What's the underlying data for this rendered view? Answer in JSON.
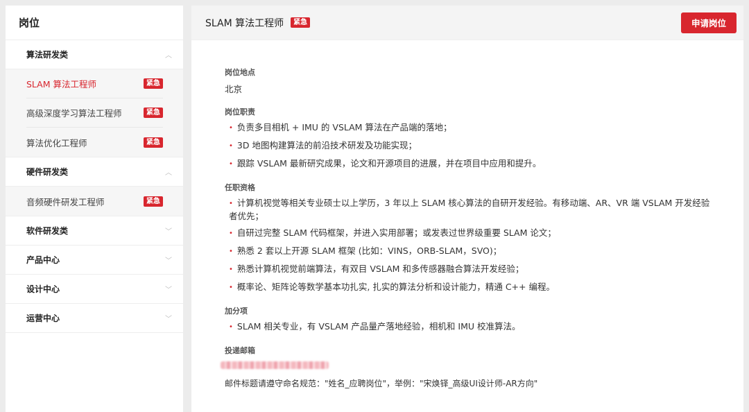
{
  "sidebar": {
    "title": "岗位",
    "groups": [
      {
        "name": "算法研发类",
        "expanded": true,
        "jobs": [
          {
            "title": "SLAM 算法工程师",
            "badge": "紧急",
            "active": true
          },
          {
            "title": "高级深度学习算法工程师",
            "badge": "紧急",
            "active": false
          },
          {
            "title": "算法优化工程师",
            "badge": "紧急",
            "active": false
          }
        ]
      },
      {
        "name": "硬件研发类",
        "expanded": true,
        "jobs": [
          {
            "title": "音频硬件研发工程师",
            "badge": "紧急",
            "active": false
          }
        ]
      },
      {
        "name": "软件研发类",
        "expanded": false,
        "jobs": []
      },
      {
        "name": "产品中心",
        "expanded": false,
        "jobs": []
      },
      {
        "name": "设计中心",
        "expanded": false,
        "jobs": []
      },
      {
        "name": "运营中心",
        "expanded": false,
        "jobs": []
      }
    ]
  },
  "detail": {
    "title": "SLAM 算法工程师",
    "badge": "紧急",
    "apply_label": "申请岗位",
    "location_label": "岗位地点",
    "location": "北京",
    "duties_label": "岗位职责",
    "duties": [
      "负责多目相机 + IMU 的 VSLAM 算法在产品端的落地；",
      "3D 地图构建算法的前沿技术研发及功能实现；",
      "跟踪 VSLAM 最新研究成果，论文和开源项目的进展，并在项目中应用和提升。"
    ],
    "requirements_label": "任职资格",
    "requirements": [
      "计算机视觉等相关专业硕士以上学历，3 年以上 SLAM 核心算法的自研开发经验。有移动端、AR、VR 端 VSLAM 开发经验者优先；",
      "自研过完整 SLAM 代码框架，并进入实用部署；或发表过世界级重要 SLAM 论文；",
      "熟悉 2 套以上开源 SLAM 框架 (比如：VINS，ORB-SLAM，SVO)；",
      "熟悉计算机视觉前端算法，有双目 VSLAM 和多传感器融合算法开发经验；",
      "概率论、矩阵论等数学基本功扎实, 扎实的算法分析和设计能力，精通 C++ 编程。"
    ],
    "bonus_label": "加分项",
    "bonus": [
      "SLAM 相关专业，有 VSLAM 产品量产落地经验，相机和 IMU 校准算法。"
    ],
    "email_label": "投递邮箱",
    "mail_note": "邮件标题请遵守命名规范：\"姓名_应聘岗位\"，举例：\"宋焕铎_高级UI设计师-AR方向\""
  },
  "colors": {
    "accent": "#d8262e",
    "background": "#ececec",
    "panel_header": "#f4f4f4"
  },
  "icons": {
    "expanded": "chevron-up-icon",
    "collapsed": "chevron-down-icon",
    "bullet": "bullet-dot-icon"
  }
}
